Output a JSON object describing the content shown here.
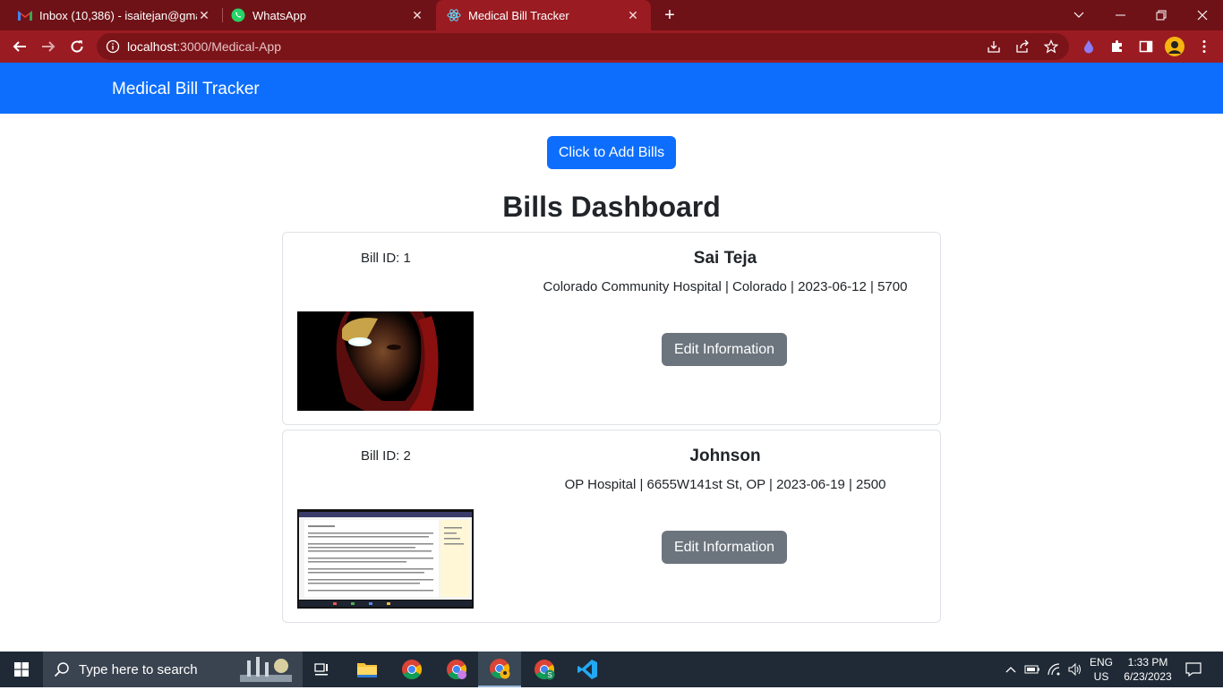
{
  "browser": {
    "tabs": [
      {
        "title": "Inbox (10,386) - isaitejan@gmail.com",
        "icon": "gmail-icon",
        "active": false
      },
      {
        "title": "WhatsApp",
        "icon": "whatsapp-icon",
        "active": false
      },
      {
        "title": "Medical Bill Tracker",
        "icon": "react-icon",
        "active": true
      }
    ],
    "url_host": "localhost",
    "url_rest": ":3000/Medical-App",
    "colors": {
      "frame": "#6e1217",
      "active_tab": "#9a1c22",
      "omnibox": "#7a1419"
    }
  },
  "app": {
    "brand": "Medical Bill Tracker",
    "add_button": "Click to Add Bills",
    "dashboard_title": "Bills Dashboard",
    "edit_label": "Edit Information",
    "colors": {
      "primary": "#0d6efd",
      "secondary": "#6c757d"
    },
    "bills": [
      {
        "id_label": "Bill ID: 1",
        "name": "Sai Teja",
        "details": "Colorado Community Hospital  | Colorado  | 2023-06-12  | 5700",
        "image": "iron-man-photo"
      },
      {
        "id_label": "Bill ID: 2",
        "name": "Johnson",
        "details": "OP Hospital  | 6655W141st St, OP  | 2023-06-19  | 2500",
        "image": "document-screenshot"
      }
    ]
  },
  "taskbar": {
    "search_placeholder": "Type here to search",
    "lang_top": "ENG",
    "lang_bottom": "US",
    "time": "1:33 PM",
    "date": "6/23/2023",
    "apps": [
      "file-explorer-icon",
      "chrome-icon",
      "chrome-profile-icon",
      "chrome-active-icon",
      "chrome-s-icon",
      "vscode-icon"
    ]
  }
}
